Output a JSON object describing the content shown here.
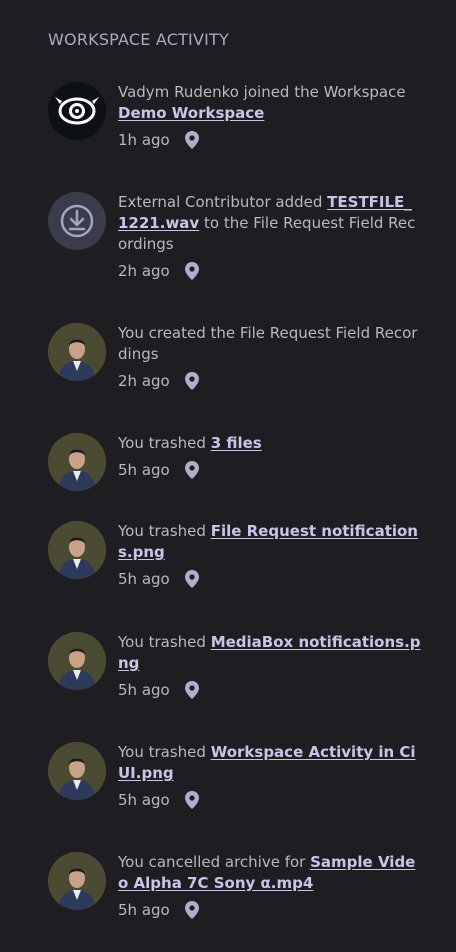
{
  "heading": "WORKSPACE ACTIVITY",
  "colors": {
    "background": "#1e1d22",
    "link": "#c7c6e6",
    "text": "#b9b8c2"
  },
  "activities": [
    {
      "avatar": "workspace-logo-icon",
      "prefix": "Vadym Rudenko joined the Workspace ",
      "link": "Demo Workspace",
      "suffix": "",
      "time": "1h ago"
    },
    {
      "avatar": "download-icon",
      "prefix": "External Contributor added ",
      "link": "TESTFILE_1221.wav",
      "suffix": " to the File Request Field Recordings",
      "time": "2h ago"
    },
    {
      "avatar": "user-avatar",
      "prefix": "You created the File Request Field Recordings",
      "link": "",
      "suffix": "",
      "time": "2h ago"
    },
    {
      "avatar": "user-avatar",
      "prefix": "You trashed ",
      "link": "3 files",
      "suffix": "",
      "time": "5h ago"
    },
    {
      "avatar": "user-avatar",
      "prefix": "You trashed ",
      "link": "File Request notifications.png",
      "suffix": "",
      "time": "5h ago"
    },
    {
      "avatar": "user-avatar",
      "prefix": "You trashed ",
      "link": "MediaBox notifications.png",
      "suffix": "",
      "time": "5h ago"
    },
    {
      "avatar": "user-avatar",
      "prefix": "You trashed ",
      "link": "Workspace Activity in Ci UI.png",
      "suffix": "",
      "time": "5h ago"
    },
    {
      "avatar": "user-avatar",
      "prefix": "You cancelled archive for ",
      "link": "Sample Video Alpha 7C Sony α.mp4",
      "suffix": "",
      "time": "5h ago"
    }
  ]
}
